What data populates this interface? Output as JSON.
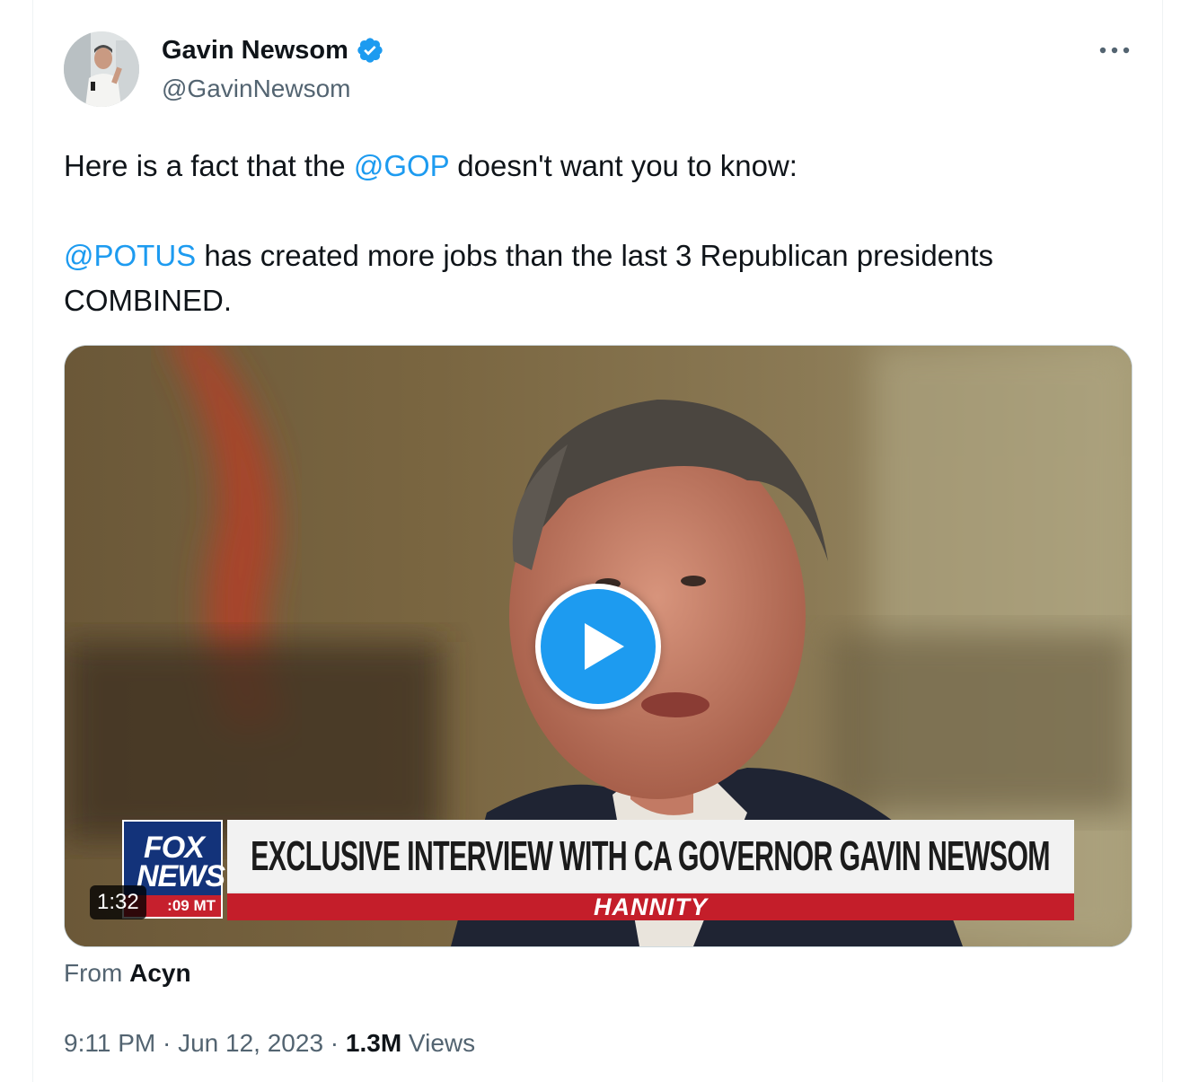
{
  "author": {
    "name": "Gavin Newsom",
    "handle": "@GavinNewsom",
    "verified": true,
    "verified_color": "#1d9bf0"
  },
  "tweet": {
    "line1_before": "Here is a fact that the ",
    "line1_mention": "@GOP",
    "line1_after": " doesn't want you to know:",
    "line2_mention": "@POTUS",
    "line2_after": " has created more jobs than the last 3 Republican presidents COMBINED.",
    "mention_color": "#1d9bf0"
  },
  "video": {
    "duration": "1:32",
    "chyron": {
      "network_line1": "FOX",
      "network_line2": "NEWS",
      "time_partial": ":09 MT",
      "headline": "EXCLUSIVE INTERVIEW WITH CA GOVERNOR GAVIN NEWSOM",
      "show": "HANNITY"
    }
  },
  "attribution": {
    "prefix": "From ",
    "source": "Acyn"
  },
  "meta": {
    "time": "9:11 PM",
    "separator": " · ",
    "date": "Jun 12, 2023",
    "views_count": "1.3M",
    "views_label": " Views"
  },
  "icons": {
    "more": "more-horizontal-icon",
    "play": "play-icon",
    "verified": "verified-badge-icon"
  }
}
